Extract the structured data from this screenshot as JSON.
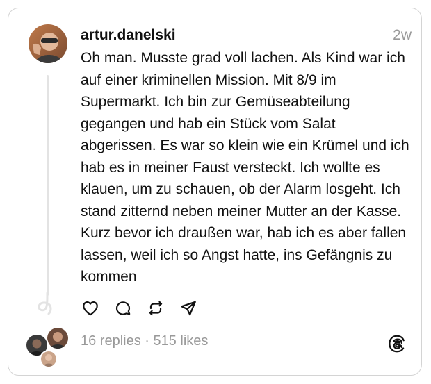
{
  "post": {
    "username": "artur.danelski",
    "time": "2w",
    "body": "Oh man. Musste grad voll lachen. Als Kind war ich auf einer kriminellen Mission. Mit 8/9 im Supermarkt. Ich bin zur Gemüseabteilung gegangen und hab ein Stück vom Salat abgerissen. Es war so klein wie ein Krümel und ich hab es in meiner Faust versteckt. Ich wollte es klauen, um zu schauen, ob der Alarm losgeht. Ich stand zitternd neben meiner Mutter an der Kasse. Kurz bevor ich draußen war, hab ich es aber fallen lassen, weil ich so Angst hatte, ins Gefängnis zu kommen",
    "stats": "16 replies · 515 likes"
  },
  "actions": [
    {
      "icon": "heart-icon"
    },
    {
      "icon": "comment-icon"
    },
    {
      "icon": "repost-icon"
    },
    {
      "icon": "share-icon"
    }
  ],
  "brand": {
    "icon": "threads-logo-icon"
  },
  "colors": {
    "text": "#111111",
    "muted": "#999999",
    "border": "#d4d4d4",
    "thread_line": "#e3e3e3"
  }
}
